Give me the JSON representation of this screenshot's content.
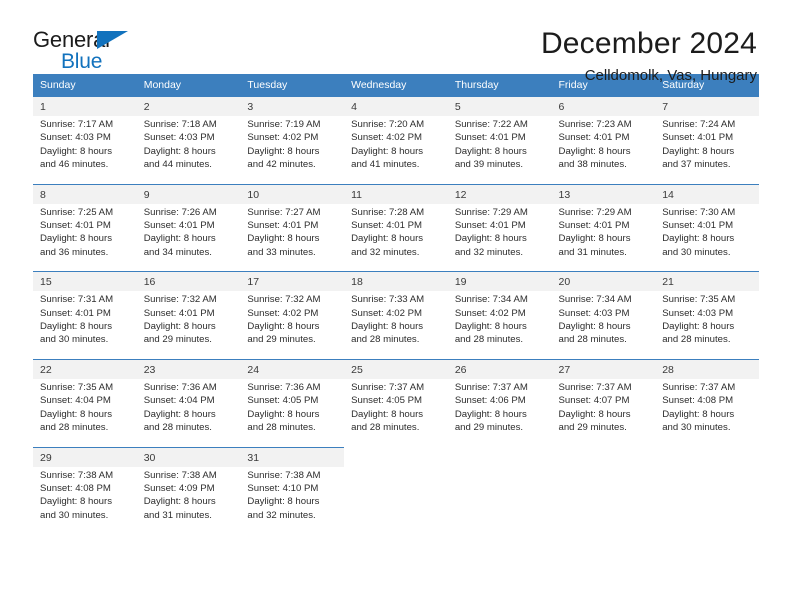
{
  "brand": {
    "name_part1": "General",
    "name_part2": "Blue",
    "triangle_icon": "brand-triangle-icon",
    "color": "#1272bd"
  },
  "header": {
    "title": "December 2024",
    "subtitle": "Celldomolk, Vas, Hungary"
  },
  "theme": {
    "header_bg": "#3c7fbe",
    "daynum_bg": "#f2f2f2",
    "text": "#2d2d2d"
  },
  "weekday_headers": [
    "Sunday",
    "Monday",
    "Tuesday",
    "Wednesday",
    "Thursday",
    "Friday",
    "Saturday"
  ],
  "weeks": [
    {
      "days": [
        {
          "date": "1",
          "sunrise": "Sunrise: 7:17 AM",
          "sunset": "Sunset: 4:03 PM",
          "daylight1": "Daylight: 8 hours",
          "daylight2": "and 46 minutes."
        },
        {
          "date": "2",
          "sunrise": "Sunrise: 7:18 AM",
          "sunset": "Sunset: 4:03 PM",
          "daylight1": "Daylight: 8 hours",
          "daylight2": "and 44 minutes."
        },
        {
          "date": "3",
          "sunrise": "Sunrise: 7:19 AM",
          "sunset": "Sunset: 4:02 PM",
          "daylight1": "Daylight: 8 hours",
          "daylight2": "and 42 minutes."
        },
        {
          "date": "4",
          "sunrise": "Sunrise: 7:20 AM",
          "sunset": "Sunset: 4:02 PM",
          "daylight1": "Daylight: 8 hours",
          "daylight2": "and 41 minutes."
        },
        {
          "date": "5",
          "sunrise": "Sunrise: 7:22 AM",
          "sunset": "Sunset: 4:01 PM",
          "daylight1": "Daylight: 8 hours",
          "daylight2": "and 39 minutes."
        },
        {
          "date": "6",
          "sunrise": "Sunrise: 7:23 AM",
          "sunset": "Sunset: 4:01 PM",
          "daylight1": "Daylight: 8 hours",
          "daylight2": "and 38 minutes."
        },
        {
          "date": "7",
          "sunrise": "Sunrise: 7:24 AM",
          "sunset": "Sunset: 4:01 PM",
          "daylight1": "Daylight: 8 hours",
          "daylight2": "and 37 minutes."
        }
      ]
    },
    {
      "days": [
        {
          "date": "8",
          "sunrise": "Sunrise: 7:25 AM",
          "sunset": "Sunset: 4:01 PM",
          "daylight1": "Daylight: 8 hours",
          "daylight2": "and 36 minutes."
        },
        {
          "date": "9",
          "sunrise": "Sunrise: 7:26 AM",
          "sunset": "Sunset: 4:01 PM",
          "daylight1": "Daylight: 8 hours",
          "daylight2": "and 34 minutes."
        },
        {
          "date": "10",
          "sunrise": "Sunrise: 7:27 AM",
          "sunset": "Sunset: 4:01 PM",
          "daylight1": "Daylight: 8 hours",
          "daylight2": "and 33 minutes."
        },
        {
          "date": "11",
          "sunrise": "Sunrise: 7:28 AM",
          "sunset": "Sunset: 4:01 PM",
          "daylight1": "Daylight: 8 hours",
          "daylight2": "and 32 minutes."
        },
        {
          "date": "12",
          "sunrise": "Sunrise: 7:29 AM",
          "sunset": "Sunset: 4:01 PM",
          "daylight1": "Daylight: 8 hours",
          "daylight2": "and 32 minutes."
        },
        {
          "date": "13",
          "sunrise": "Sunrise: 7:29 AM",
          "sunset": "Sunset: 4:01 PM",
          "daylight1": "Daylight: 8 hours",
          "daylight2": "and 31 minutes."
        },
        {
          "date": "14",
          "sunrise": "Sunrise: 7:30 AM",
          "sunset": "Sunset: 4:01 PM",
          "daylight1": "Daylight: 8 hours",
          "daylight2": "and 30 minutes."
        }
      ]
    },
    {
      "days": [
        {
          "date": "15",
          "sunrise": "Sunrise: 7:31 AM",
          "sunset": "Sunset: 4:01 PM",
          "daylight1": "Daylight: 8 hours",
          "daylight2": "and 30 minutes."
        },
        {
          "date": "16",
          "sunrise": "Sunrise: 7:32 AM",
          "sunset": "Sunset: 4:01 PM",
          "daylight1": "Daylight: 8 hours",
          "daylight2": "and 29 minutes."
        },
        {
          "date": "17",
          "sunrise": "Sunrise: 7:32 AM",
          "sunset": "Sunset: 4:02 PM",
          "daylight1": "Daylight: 8 hours",
          "daylight2": "and 29 minutes."
        },
        {
          "date": "18",
          "sunrise": "Sunrise: 7:33 AM",
          "sunset": "Sunset: 4:02 PM",
          "daylight1": "Daylight: 8 hours",
          "daylight2": "and 28 minutes."
        },
        {
          "date": "19",
          "sunrise": "Sunrise: 7:34 AM",
          "sunset": "Sunset: 4:02 PM",
          "daylight1": "Daylight: 8 hours",
          "daylight2": "and 28 minutes."
        },
        {
          "date": "20",
          "sunrise": "Sunrise: 7:34 AM",
          "sunset": "Sunset: 4:03 PM",
          "daylight1": "Daylight: 8 hours",
          "daylight2": "and 28 minutes."
        },
        {
          "date": "21",
          "sunrise": "Sunrise: 7:35 AM",
          "sunset": "Sunset: 4:03 PM",
          "daylight1": "Daylight: 8 hours",
          "daylight2": "and 28 minutes."
        }
      ]
    },
    {
      "days": [
        {
          "date": "22",
          "sunrise": "Sunrise: 7:35 AM",
          "sunset": "Sunset: 4:04 PM",
          "daylight1": "Daylight: 8 hours",
          "daylight2": "and 28 minutes."
        },
        {
          "date": "23",
          "sunrise": "Sunrise: 7:36 AM",
          "sunset": "Sunset: 4:04 PM",
          "daylight1": "Daylight: 8 hours",
          "daylight2": "and 28 minutes."
        },
        {
          "date": "24",
          "sunrise": "Sunrise: 7:36 AM",
          "sunset": "Sunset: 4:05 PM",
          "daylight1": "Daylight: 8 hours",
          "daylight2": "and 28 minutes."
        },
        {
          "date": "25",
          "sunrise": "Sunrise: 7:37 AM",
          "sunset": "Sunset: 4:05 PM",
          "daylight1": "Daylight: 8 hours",
          "daylight2": "and 28 minutes."
        },
        {
          "date": "26",
          "sunrise": "Sunrise: 7:37 AM",
          "sunset": "Sunset: 4:06 PM",
          "daylight1": "Daylight: 8 hours",
          "daylight2": "and 29 minutes."
        },
        {
          "date": "27",
          "sunrise": "Sunrise: 7:37 AM",
          "sunset": "Sunset: 4:07 PM",
          "daylight1": "Daylight: 8 hours",
          "daylight2": "and 29 minutes."
        },
        {
          "date": "28",
          "sunrise": "Sunrise: 7:37 AM",
          "sunset": "Sunset: 4:08 PM",
          "daylight1": "Daylight: 8 hours",
          "daylight2": "and 30 minutes."
        }
      ]
    },
    {
      "days": [
        {
          "date": "29",
          "sunrise": "Sunrise: 7:38 AM",
          "sunset": "Sunset: 4:08 PM",
          "daylight1": "Daylight: 8 hours",
          "daylight2": "and 30 minutes."
        },
        {
          "date": "30",
          "sunrise": "Sunrise: 7:38 AM",
          "sunset": "Sunset: 4:09 PM",
          "daylight1": "Daylight: 8 hours",
          "daylight2": "and 31 minutes."
        },
        {
          "date": "31",
          "sunrise": "Sunrise: 7:38 AM",
          "sunset": "Sunset: 4:10 PM",
          "daylight1": "Daylight: 8 hours",
          "daylight2": "and 32 minutes."
        },
        {
          "date": "",
          "sunrise": "",
          "sunset": "",
          "daylight1": "",
          "daylight2": ""
        },
        {
          "date": "",
          "sunrise": "",
          "sunset": "",
          "daylight1": "",
          "daylight2": ""
        },
        {
          "date": "",
          "sunrise": "",
          "sunset": "",
          "daylight1": "",
          "daylight2": ""
        },
        {
          "date": "",
          "sunrise": "",
          "sunset": "",
          "daylight1": "",
          "daylight2": ""
        }
      ]
    }
  ]
}
